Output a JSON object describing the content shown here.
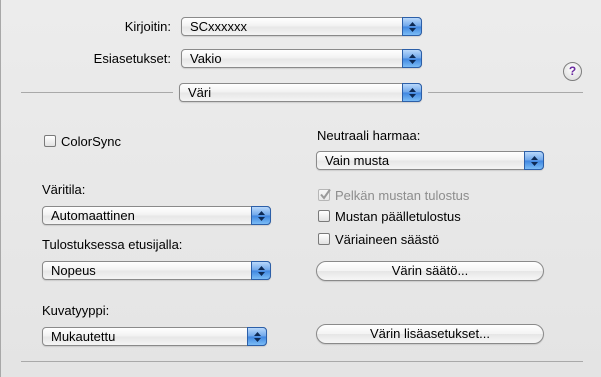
{
  "header": {
    "printer_label": "Kirjoitin:",
    "printer_value": "SCxxxxxx",
    "presets_label": "Esiasetukset:",
    "presets_value": "Vakio",
    "panel_value": "Väri",
    "help_symbol": "?"
  },
  "left": {
    "colorsync_label": "ColorSync",
    "color_mode_label": "Väritila:",
    "color_mode_value": "Automaattinen",
    "priority_label": "Tulostuksessa etusijalla:",
    "priority_value": "Nopeus",
    "image_type_label": "Kuvatyyppi:",
    "image_type_value": "Mukautettu"
  },
  "right": {
    "neutral_gray_label": "Neutraali harmaa:",
    "neutral_gray_value": "Vain musta",
    "black_only_label": "Pelkän mustan tulostus",
    "black_overprint_label": "Mustan päälletulostus",
    "ink_save_label": "Väriaineen säästö",
    "color_adjust_button": "Värin säätö...",
    "advanced_color_button": "Värin lisäasetukset..."
  },
  "states": {
    "colorsync_checked": false,
    "black_only_checked": true,
    "black_only_disabled": true,
    "black_overprint_checked": false,
    "ink_save_checked": false
  },
  "colors": {
    "popup_arrow_accent": "#3f86e0",
    "help_glyph": "#6a2aa0",
    "disabled_text": "#8d8d8d"
  }
}
